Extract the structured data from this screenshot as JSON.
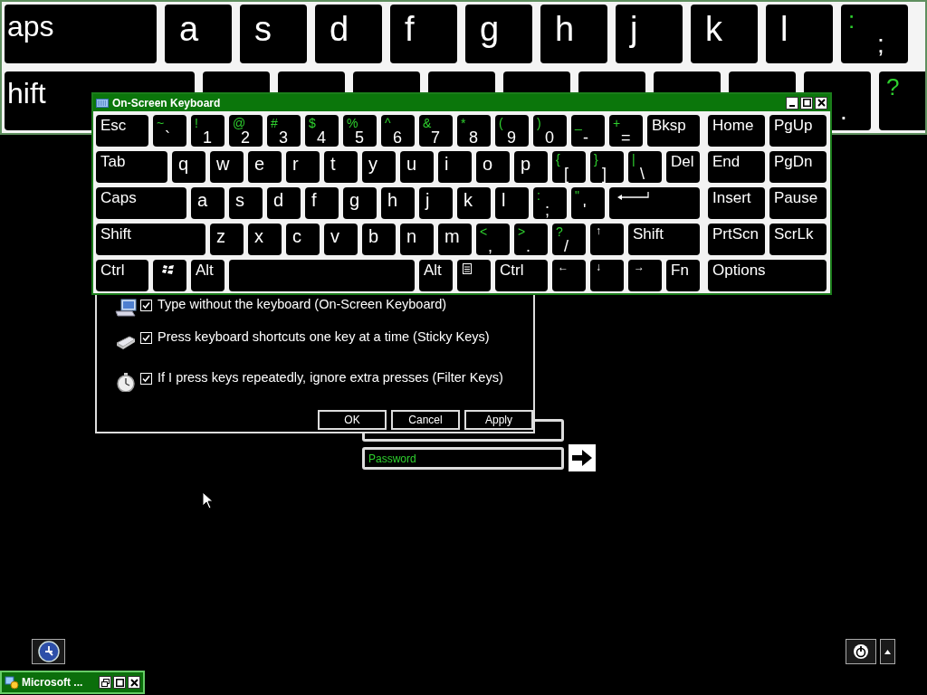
{
  "magnifier": {
    "rows": [
      [
        {
          "kind": "word",
          "main": "aps"
        },
        {
          "kind": "letter",
          "main": "a"
        },
        {
          "kind": "letter",
          "main": "s"
        },
        {
          "kind": "letter",
          "main": "d"
        },
        {
          "kind": "letter",
          "main": "f"
        },
        {
          "kind": "letter",
          "main": "g"
        },
        {
          "kind": "letter",
          "main": "h"
        },
        {
          "kind": "letter",
          "main": "j"
        },
        {
          "kind": "letter",
          "main": "k"
        },
        {
          "kind": "letter",
          "main": "l"
        },
        {
          "kind": "dual",
          "shift": ":",
          "main": ";"
        }
      ],
      [
        {
          "kind": "word",
          "main": "hift"
        },
        {
          "kind": "blank"
        },
        {
          "kind": "blank"
        },
        {
          "kind": "blank"
        },
        {
          "kind": "blank"
        },
        {
          "kind": "blank"
        },
        {
          "kind": "blank"
        },
        {
          "kind": "blank"
        },
        {
          "kind": "blank"
        },
        {
          "kind": "dual",
          "main": "."
        },
        {
          "kind": "dual",
          "shift": "?"
        }
      ]
    ]
  },
  "osk": {
    "title": "On-Screen Keyboard",
    "rows": [
      {
        "keys": [
          {
            "kind": "word",
            "main": "Esc"
          },
          {
            "kind": "dual",
            "shift": "~",
            "main": "`"
          },
          {
            "kind": "dual",
            "shift": "!",
            "main": "1"
          },
          {
            "kind": "dual",
            "shift": "@",
            "main": "2"
          },
          {
            "kind": "dual",
            "shift": "#",
            "main": "3"
          },
          {
            "kind": "dual",
            "shift": "$",
            "main": "4"
          },
          {
            "kind": "dual",
            "shift": "%",
            "main": "5"
          },
          {
            "kind": "dual",
            "shift": "^",
            "main": "6"
          },
          {
            "kind": "dual",
            "shift": "&",
            "main": "7"
          },
          {
            "kind": "dual",
            "shift": "*",
            "main": "8"
          },
          {
            "kind": "dual",
            "shift": "(",
            "main": "9"
          },
          {
            "kind": "dual",
            "shift": ")",
            "main": "0"
          },
          {
            "kind": "dual",
            "shift": "_",
            "main": "-"
          },
          {
            "kind": "dual",
            "shift": "+",
            "main": "="
          },
          {
            "kind": "word",
            "main": "Bksp"
          }
        ]
      },
      {
        "keys": [
          {
            "kind": "word",
            "main": "Tab"
          },
          {
            "kind": "letter",
            "main": "q"
          },
          {
            "kind": "letter",
            "main": "w"
          },
          {
            "kind": "letter",
            "main": "e"
          },
          {
            "kind": "letter",
            "main": "r"
          },
          {
            "kind": "letter",
            "main": "t"
          },
          {
            "kind": "letter",
            "main": "y"
          },
          {
            "kind": "letter",
            "main": "u"
          },
          {
            "kind": "letter",
            "main": "i"
          },
          {
            "kind": "letter",
            "main": "o"
          },
          {
            "kind": "letter",
            "main": "p"
          },
          {
            "kind": "dual",
            "shift": "{",
            "main": "["
          },
          {
            "kind": "dual",
            "shift": "}",
            "main": "]"
          },
          {
            "kind": "dual",
            "shift": "|",
            "main": "\\"
          },
          {
            "kind": "word",
            "main": "Del"
          }
        ]
      },
      {
        "keys": [
          {
            "kind": "word",
            "main": "Caps"
          },
          {
            "kind": "letter",
            "main": "a"
          },
          {
            "kind": "letter",
            "main": "s"
          },
          {
            "kind": "letter",
            "main": "d"
          },
          {
            "kind": "letter",
            "main": "f"
          },
          {
            "kind": "letter",
            "main": "g"
          },
          {
            "kind": "letter",
            "main": "h"
          },
          {
            "kind": "letter",
            "main": "j"
          },
          {
            "kind": "letter",
            "main": "k"
          },
          {
            "kind": "letter",
            "main": "l"
          },
          {
            "kind": "dual",
            "shift": ":",
            "main": ";"
          },
          {
            "kind": "dual",
            "shift": "\"",
            "main": "'"
          },
          {
            "kind": "enter"
          }
        ]
      },
      {
        "keys": [
          {
            "kind": "word",
            "main": "Shift"
          },
          {
            "kind": "letter",
            "main": "z"
          },
          {
            "kind": "letter",
            "main": "x"
          },
          {
            "kind": "letter",
            "main": "c"
          },
          {
            "kind": "letter",
            "main": "v"
          },
          {
            "kind": "letter",
            "main": "b"
          },
          {
            "kind": "letter",
            "main": "n"
          },
          {
            "kind": "letter",
            "main": "m"
          },
          {
            "kind": "dual",
            "shift": "<",
            "main": ","
          },
          {
            "kind": "dual",
            "shift": ">",
            "main": "."
          },
          {
            "kind": "dual",
            "shift": "?",
            "main": "/"
          },
          {
            "kind": "arrow",
            "main": "↑"
          },
          {
            "kind": "word",
            "main": "Shift"
          }
        ]
      },
      {
        "keys": [
          {
            "kind": "word",
            "main": "Ctrl"
          },
          {
            "kind": "win"
          },
          {
            "kind": "word",
            "main": "Alt"
          },
          {
            "kind": "space"
          },
          {
            "kind": "word",
            "main": "Alt"
          },
          {
            "kind": "menu"
          },
          {
            "kind": "word",
            "main": "Ctrl"
          },
          {
            "kind": "arrow",
            "main": "←"
          },
          {
            "kind": "arrow",
            "main": "↓"
          },
          {
            "kind": "arrow",
            "main": "→"
          },
          {
            "kind": "word",
            "main": "Fn"
          }
        ]
      }
    ],
    "nav_rows": [
      [
        "Home",
        "PgUp"
      ],
      [
        "End",
        "PgDn"
      ],
      [
        "Insert",
        "Pause"
      ],
      [
        "PrtScn",
        "ScrLk"
      ],
      [
        "Options"
      ]
    ]
  },
  "dialog": {
    "options": [
      {
        "checked": true,
        "text": "Type without the keyboard (On-Screen Keyboard)"
      },
      {
        "checked": true,
        "text": "Press keyboard shortcuts one key at a time (Sticky Keys)"
      },
      {
        "checked": true,
        "text": "If I press keys repeatedly, ignore extra presses (Filter Keys)"
      }
    ],
    "buttons": [
      "OK",
      "Cancel",
      "Apply"
    ]
  },
  "login": {
    "password_placeholder": "Password"
  },
  "taskbar_item": {
    "title": "Microsoft ..."
  }
}
